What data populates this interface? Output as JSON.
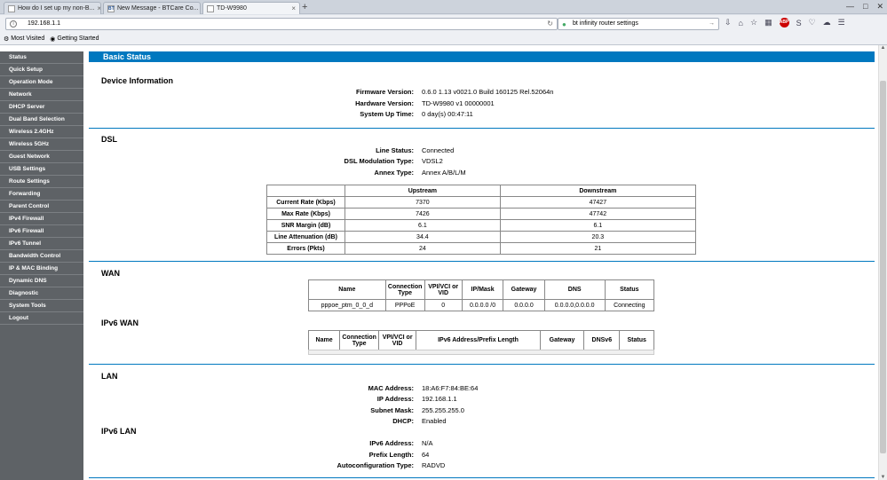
{
  "browser": {
    "tabs": [
      {
        "label": "How do I set up my non-B...",
        "favicon": "page"
      },
      {
        "label": "New Message - BTCare Co...",
        "favicon": "BT"
      },
      {
        "label": "TD-W9980",
        "favicon": "page"
      }
    ],
    "new_tab": "+",
    "url": "192.168.1.1",
    "search": "bt infinity router settings",
    "bookmarks": [
      "Most Visited",
      "Getting Started"
    ]
  },
  "sidebar": {
    "items": [
      "Status",
      "Quick Setup",
      "Operation Mode",
      "Network",
      "DHCP Server",
      "Dual Band Selection",
      "Wireless 2.4GHz",
      "Wireless 5GHz",
      "Guest Network",
      "USB Settings",
      "Route Settings",
      "Forwarding",
      "Parent Control",
      "IPv4 Firewall",
      "IPv6 Firewall",
      "IPv6 Tunnel",
      "Bandwidth Control",
      "IP & MAC Binding",
      "Dynamic DNS",
      "Diagnostic",
      "System Tools",
      "Logout"
    ]
  },
  "page_title": "Basic Status",
  "device": {
    "title": "Device Information",
    "firmware_label": "Firmware Version:",
    "firmware": "0.6.0 1.13 v0021.0 Build 160125 Rel.52064n",
    "hardware_label": "Hardware Version:",
    "hardware": "TD-W9980 v1 00000001",
    "uptime_label": "System Up Time:",
    "uptime": "0 day(s) 00:47:11"
  },
  "dsl": {
    "title": "DSL",
    "line_status_label": "Line Status:",
    "line_status": "Connected",
    "modulation_label": "DSL Modulation Type:",
    "modulation": "VDSL2",
    "annex_label": "Annex Type:",
    "annex": "Annex A/B/L/M",
    "col_upstream": "Upstream",
    "col_downstream": "Downstream",
    "rows": [
      {
        "label": "Current Rate (Kbps)",
        "up": "7370",
        "down": "47427"
      },
      {
        "label": "Max Rate (Kbps)",
        "up": "7426",
        "down": "47742"
      },
      {
        "label": "SNR Margin (dB)",
        "up": "6.1",
        "down": "6.1"
      },
      {
        "label": "Line Attenuation (dB)",
        "up": "34.4",
        "down": "20.3"
      },
      {
        "label": "Errors (Pkts)",
        "up": "24",
        "down": "21"
      }
    ]
  },
  "wan": {
    "title": "WAN",
    "headers": [
      "Name",
      "Connection Type",
      "VPI/VCI or VID",
      "IP/Mask",
      "Gateway",
      "DNS",
      "Status"
    ],
    "row": [
      "pppoe_ptm_0_0_d",
      "PPPoE",
      "0",
      "0.0.0.0 /0",
      "0.0.0.0",
      "0.0.0.0,0.0.0.0",
      "Connecting"
    ]
  },
  "ipv6wan": {
    "title": "IPv6 WAN",
    "headers": [
      "Name",
      "Connection Type",
      "VPI/VCI or VID",
      "IPv6 Address/Prefix Length",
      "Gateway",
      "DNSv6",
      "Status"
    ]
  },
  "lan": {
    "title": "LAN",
    "mac_label": "MAC Address:",
    "mac": "18:A6:F7:84:BE:64",
    "ip_label": "IP Address:",
    "ip": "192.168.1.1",
    "mask_label": "Subnet Mask:",
    "mask": "255.255.255.0",
    "dhcp_label": "DHCP:",
    "dhcp": "Enabled"
  },
  "ipv6lan": {
    "title": "IPv6 LAN",
    "addr_label": "IPv6 Address:",
    "addr": "N/A",
    "prefix_label": "Prefix Length:",
    "prefix": "64",
    "autoconf_label": "Autoconfiguration Type:",
    "autoconf": "RADVD"
  },
  "colors": {
    "accent": "#0078bf",
    "sidebar": "#5e6266"
  }
}
